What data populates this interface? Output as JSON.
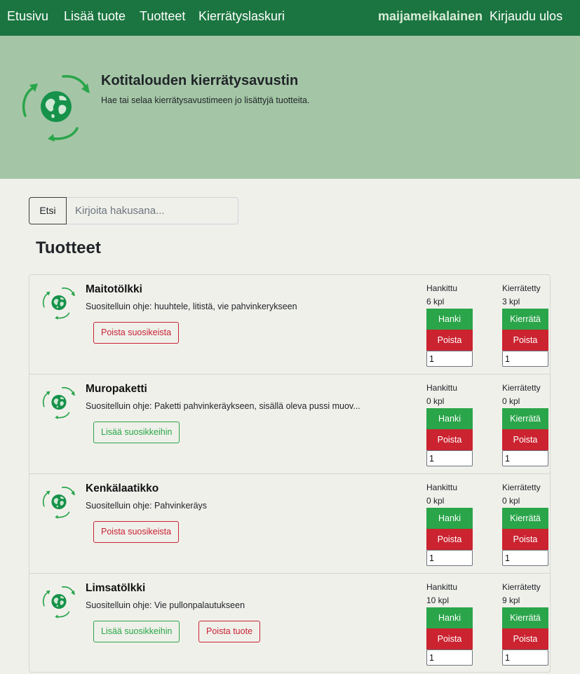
{
  "nav": {
    "links": [
      "Etusivu",
      "Lisää tuote",
      "Tuotteet",
      "Kierrätyslaskuri"
    ],
    "username": "maijameikalainen",
    "logout": "Kirjaudu ulos"
  },
  "hero": {
    "title": "Kotitalouden kierrätysavustin",
    "subtitle": "Hae tai selaa kierrätysavustimeen jo lisättyjä tuotteita."
  },
  "search": {
    "button": "Etsi",
    "placeholder": "Kirjoita hakusana..."
  },
  "section_title": "Tuotteet",
  "labels": {
    "acquired": "Hankittu",
    "recycled": "Kierrätetty",
    "acquire_btn": "Hanki",
    "recycle_btn": "Kierrätä",
    "remove_btn": "Poista",
    "fav_remove": "Poista suosikeista",
    "fav_add": "Lisää suosikkeihin",
    "delete_product": "Poista tuote"
  },
  "products": [
    {
      "name": "Maitotölkki",
      "instruction": "Suositelluin ohje: huuhtele, litistä, vie pahvinkerykseen",
      "acquired": "6 kpl",
      "recycled": "3 kpl",
      "qty_acquire": "1",
      "qty_recycle": "1"
    },
    {
      "name": "Muropaketti",
      "instruction": "Suositelluin ohje: Paketti pahvinkeräykseen, sisällä oleva pussi muov...",
      "acquired": "0 kpl",
      "recycled": "0 kpl",
      "qty_acquire": "1",
      "qty_recycle": "1"
    },
    {
      "name": "Kenkälaatikko",
      "instruction": "Suositelluin ohje: Pahvinkeräys",
      "acquired": "0 kpl",
      "recycled": "0 kpl",
      "qty_acquire": "1",
      "qty_recycle": "1"
    },
    {
      "name": "Limsatölkki",
      "instruction": "Suositelluin ohje: Vie pullonpalautukseen",
      "acquired": "10 kpl",
      "recycled": "9 kpl",
      "qty_acquire": "1",
      "qty_recycle": "1"
    }
  ],
  "colors": {
    "navbar": "#1b7540",
    "hero": "#a4c6a6",
    "success": "#2aa54a",
    "danger": "#cb2330",
    "background": "#f0f0eb"
  },
  "icons": {
    "logo": "recycling-globe-icon"
  }
}
